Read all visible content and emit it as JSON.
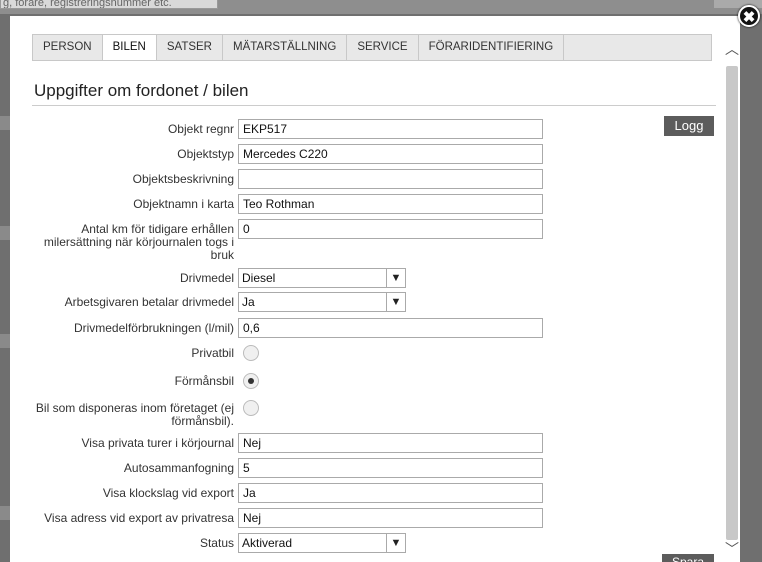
{
  "background": {
    "search_placeholder": "g, förare, registreringsnummer etc."
  },
  "close_icon": "✖",
  "tabs": [
    {
      "label": "PERSON",
      "active": false
    },
    {
      "label": "BILEN",
      "active": true
    },
    {
      "label": "SATSER",
      "active": false
    },
    {
      "label": "MÄTARSTÄLLNING",
      "active": false
    },
    {
      "label": "SERVICE",
      "active": false
    },
    {
      "label": "FÖRARIDENTIFIERING",
      "active": false
    }
  ],
  "heading": "Uppgifter om fordonet / bilen",
  "logg_label": "Logg",
  "form": {
    "objekt_regnr": {
      "label": "Objekt regnr",
      "value": "EKP517"
    },
    "objektstyp": {
      "label": "Objektstyp",
      "value": "Mercedes C220"
    },
    "objektsbeskrivning": {
      "label": "Objektsbeskrivning",
      "value": ""
    },
    "objektnamn": {
      "label": "Objektnamn i karta",
      "value": "Teo Rothman"
    },
    "antal_km": {
      "label": "Antal km för tidigare erhållen milersättning när körjournalen togs i bruk",
      "value": "0"
    },
    "drivmedel": {
      "label": "Drivmedel",
      "value": "Diesel"
    },
    "arbetsgivaren": {
      "label": "Arbetsgivaren betalar drivmedel",
      "value": "Ja"
    },
    "forbrukning": {
      "label": "Drivmedelförbrukningen (l/mil)",
      "value": "0,6"
    },
    "privatbil": {
      "label": "Privatbil",
      "checked": false
    },
    "formansbil": {
      "label": "Förmånsbil",
      "checked": true
    },
    "bil_disponeras": {
      "label": "Bil som disponeras inom företaget (ej förmånsbil).",
      "checked": false
    },
    "visa_privata": {
      "label": "Visa privata turer i körjournal",
      "value": "Nej"
    },
    "autosammanfogning": {
      "label": "Autosammanfogning",
      "value": "5"
    },
    "visa_klockslag": {
      "label": "Visa klockslag vid export",
      "value": "Ja"
    },
    "visa_adress": {
      "label": "Visa adress vid export av privatresa",
      "value": "Nej"
    },
    "status": {
      "label": "Status",
      "value": "Aktiverad"
    }
  },
  "spara_label": "Spara",
  "colors": {
    "overlay": "#6f6f6f",
    "button": "#5c5c5c",
    "tab_bar": "#e8e8e8"
  }
}
